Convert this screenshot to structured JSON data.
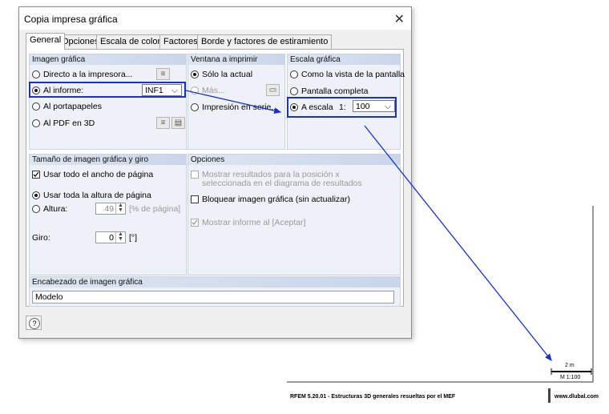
{
  "dialog": {
    "title": "Copia impresa gráfica",
    "close_glyph": "✕",
    "tabs": [
      "General",
      "Opciones",
      "Escala de colores",
      "Factores",
      "Borde y factores de estiramiento"
    ]
  },
  "imagen_grafica": {
    "header": "Imagen gráfica",
    "directo": "Directo a la impresora...",
    "informe": "Al informe:",
    "informe_value": "INF1",
    "portapapeles": "Al portapapeles",
    "pdf": "Al PDF en 3D"
  },
  "ventana": {
    "header": "Ventana a imprimir",
    "solo": "Sólo la actual",
    "mas": "Más...",
    "serie": "Impresión en serie..."
  },
  "escala": {
    "header": "Escala gráfica",
    "vista": "Como la vista de la pantalla",
    "completa": "Pantalla completa",
    "a_escala": "A escala",
    "ratio": "1:",
    "value": "100"
  },
  "tamano": {
    "header": "Tamaño de imagen gráfica y giro",
    "ancho": "Usar todo el ancho de página",
    "altura_toda": "Usar toda la altura de página",
    "altura": "Altura:",
    "altura_value": "49",
    "altura_unit": "[% de página]",
    "giro": "Giro:",
    "giro_value": "0",
    "giro_unit": "[°]"
  },
  "opciones": {
    "header": "Opciones",
    "mostrar_resultados": "Mostrar resultados para la posición x",
    "mostrar_resultados_2": "seleccionada en el diagrama de resultados",
    "bloquear": "Bloquear imagen gráfica (sin actualizar)",
    "mostrar_informe": "Mostrar informe al [Aceptar]"
  },
  "encabezado": {
    "header": "Encabezado de imagen gráfica",
    "value": "Modelo"
  },
  "page": {
    "scale_length": "2 m",
    "scale_label": "M 1:100",
    "footer_left": "RFEM 5.20.01 - Estructuras 3D generales resueltas por el MEF",
    "footer_right": "www.dlubal.com"
  },
  "colors": {
    "highlight": "#1a31c9",
    "node": "#3cbf3c"
  }
}
